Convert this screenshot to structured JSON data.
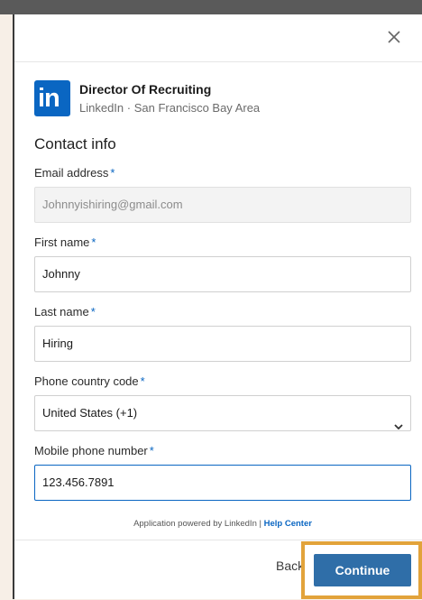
{
  "job": {
    "title": "Director Of Recruiting",
    "subtitle": "LinkedIn · San Francisco Bay Area",
    "logo_text": "in"
  },
  "section_title": "Contact info",
  "fields": {
    "email": {
      "label": "Email address",
      "required": "*",
      "value": "Johnnyishiring@gmail.com"
    },
    "first_name": {
      "label": "First name",
      "required": "*",
      "value": "Johnny"
    },
    "last_name": {
      "label": "Last name",
      "required": "*",
      "value": "Hiring"
    },
    "phone_code": {
      "label": "Phone country code",
      "required": "*",
      "value": "United States (+1)"
    },
    "mobile": {
      "label": "Mobile phone number",
      "required": "*",
      "value": "123.456.7891"
    }
  },
  "powered": {
    "text": "Application powered by LinkedIn | ",
    "link": "Help Center"
  },
  "footer": {
    "back_label": "Back",
    "continue_label": "Continue"
  },
  "colors": {
    "accent": "#0a66c2",
    "button": "#2f6ea8",
    "highlight": "#e2a33b"
  },
  "icons": {
    "close": "close-icon",
    "dropdown": "chevron-down-icon"
  }
}
